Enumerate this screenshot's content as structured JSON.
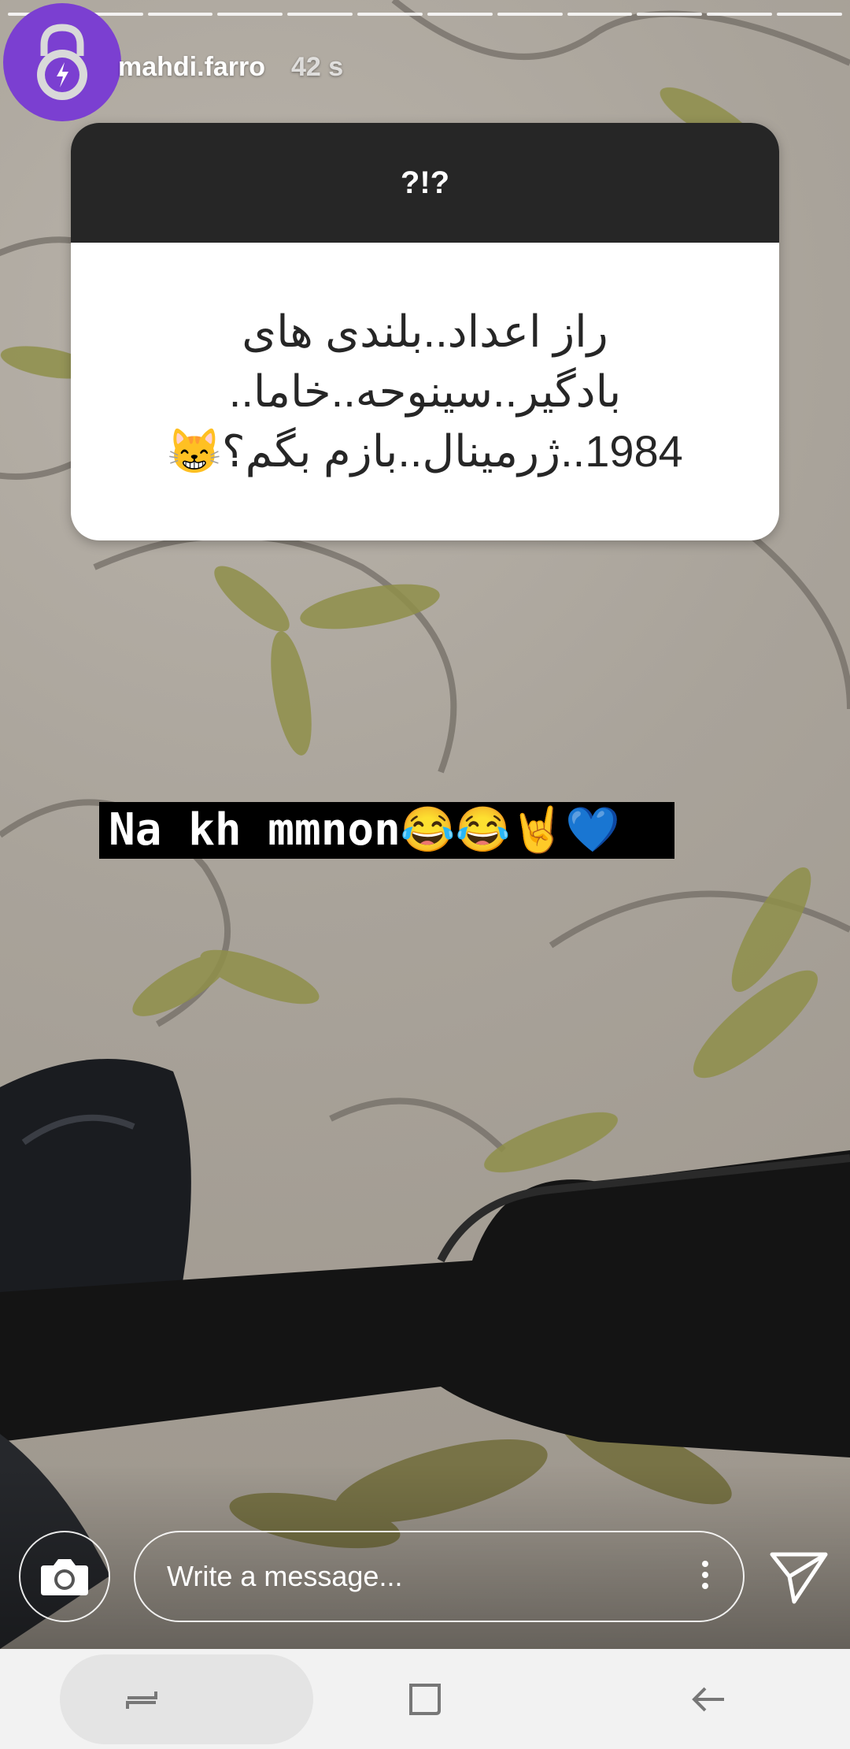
{
  "story": {
    "username": "mahdi.farro",
    "time_ago": "42 s",
    "segments": 12
  },
  "question_card": {
    "header": "?!?",
    "answer_lines": [
      "راز اعداد..بلندی های",
      "بادگیر..سینوحه..خاما..",
      "1984..ژرمینال..بازم بگم؟😸"
    ]
  },
  "caption": {
    "text": "Na kh mmnon😂😂🤘💙"
  },
  "composer": {
    "placeholder": "Write a message..."
  },
  "icons": {
    "avatar": "lock-icon",
    "camera": "camera-icon",
    "more": "more-dots-icon",
    "send": "send-icon",
    "nav_recent": "recent-apps-icon",
    "nav_home": "home-icon",
    "nav_back": "back-icon"
  },
  "colors": {
    "avatar_bg": "#7b3fd1",
    "card_header_bg": "#262626",
    "navbar_bg": "#f2f2f2"
  }
}
